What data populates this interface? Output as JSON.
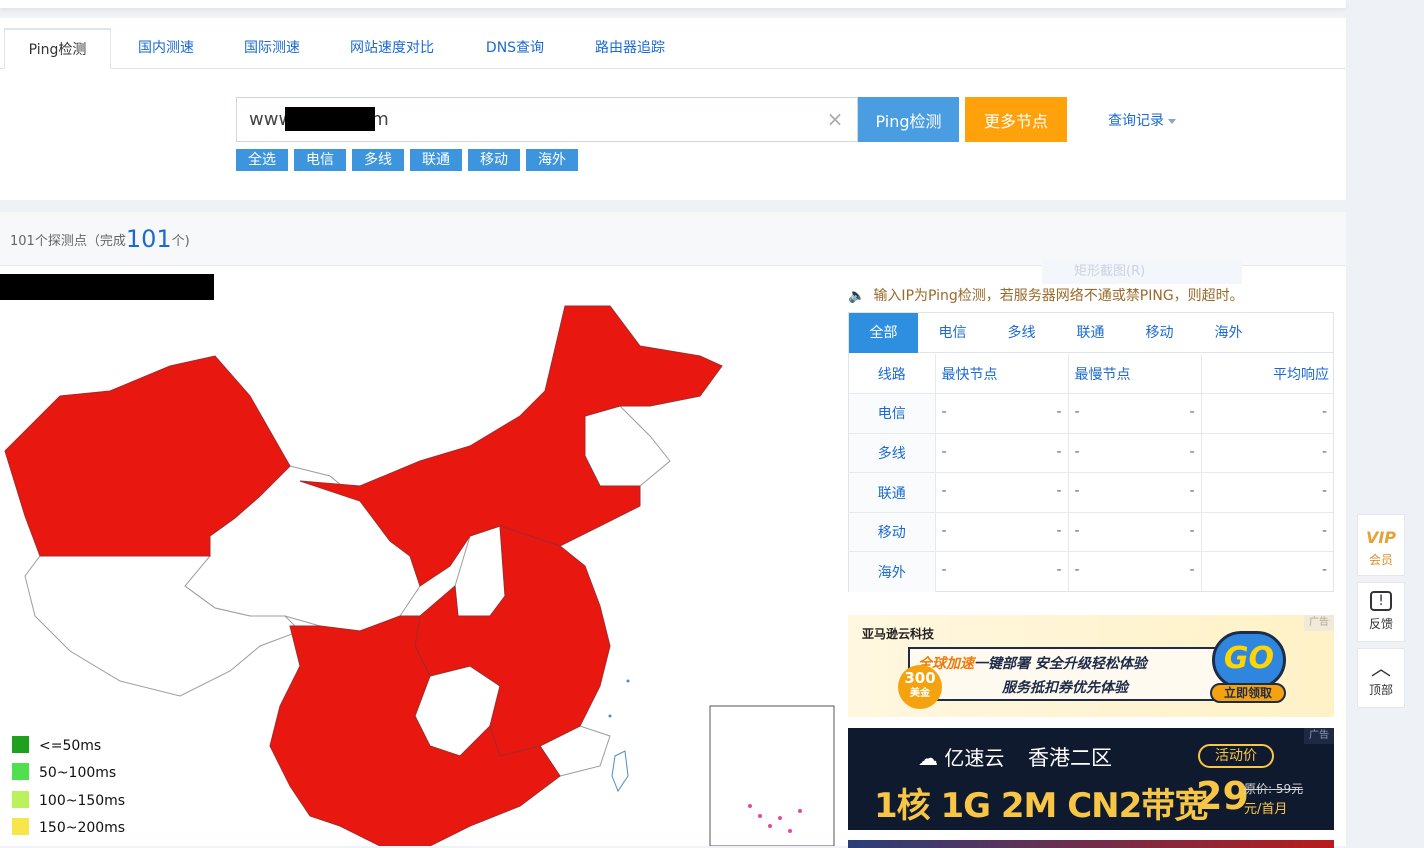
{
  "tabs": [
    "Ping检测",
    "国内测速",
    "国际测速",
    "网站速度对比",
    "DNS查询",
    "路由器追踪"
  ],
  "search": {
    "value": "www          com",
    "ping_label": "Ping检测",
    "more_label": "更多节点",
    "history_label": "查询记录"
  },
  "filters": [
    "全选",
    "电信",
    "多线",
    "联通",
    "移动",
    "海外"
  ],
  "summary": {
    "prefix": "101个探测点（完成",
    "count": "101",
    "suffix": "个)"
  },
  "ghost_menu": "矩形截图(R)",
  "legend": [
    {
      "label": "<=50ms",
      "color": "#1fa01f"
    },
    {
      "label": "50~100ms",
      "color": "#4fe04f"
    },
    {
      "label": "100~150ms",
      "color": "#b9f25a"
    },
    {
      "label": "150~200ms",
      "color": "#f6e64a"
    }
  ],
  "map": {
    "fill_red": "#e8170f",
    "fill_white": "#ffffff",
    "border": "#9c9c9c"
  },
  "notice": "输入IP为Ping检测，若服务器网络不通或禁PING，则超时。",
  "result_tabs": [
    "全部",
    "电信",
    "多线",
    "联通",
    "移动",
    "海外"
  ],
  "table": {
    "headers": [
      "线路",
      "最快节点",
      "最慢节点",
      "平均响应"
    ],
    "rows": [
      {
        "line": "电信",
        "fast": [
          "-",
          "-"
        ],
        "slow": [
          "-",
          "-"
        ],
        "avg": "-"
      },
      {
        "line": "多线",
        "fast": [
          "-",
          "-"
        ],
        "slow": [
          "-",
          "-"
        ],
        "avg": "-"
      },
      {
        "line": "联通",
        "fast": [
          "-",
          "-"
        ],
        "slow": [
          "-",
          "-"
        ],
        "avg": "-"
      },
      {
        "line": "移动",
        "fast": [
          "-",
          "-"
        ],
        "slow": [
          "-",
          "-"
        ],
        "avg": "-"
      },
      {
        "line": "海外",
        "fast": [
          "-",
          "-"
        ],
        "slow": [
          "-",
          "-"
        ],
        "avg": "-"
      }
    ]
  },
  "ad1": {
    "tag": "广告",
    "brand": "亚马逊云科技",
    "line1_highlight": "全球加速",
    "line1_rest": "一键部署  安全升级轻松体验",
    "line2": "服务抵扣券优先体验",
    "coin_amount": "300",
    "coin_unit": "美金",
    "go": "GO",
    "cta": "立即领取"
  },
  "ad2": {
    "tag": "广告",
    "logo": "亿速云",
    "region": "香港二区",
    "badge": "活动价",
    "spec": "1核 1G 2M CN2带宽",
    "price": "29",
    "orig": "原价: 59元",
    "per": "元/首月"
  },
  "side": [
    {
      "icon": "VIP",
      "label": "会员"
    },
    {
      "icon": "!",
      "label": "反馈"
    },
    {
      "icon": "︿",
      "label": "顶部"
    }
  ]
}
